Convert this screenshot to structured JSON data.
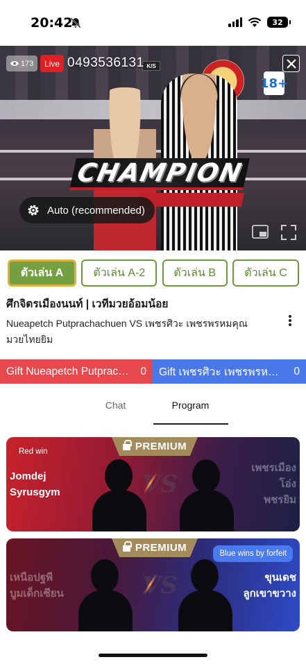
{
  "status_bar": {
    "time": "20:42",
    "battery": "32"
  },
  "video": {
    "view_count": "173",
    "live_label": "Live",
    "overlay_number": "0493536131",
    "overlay_champion_text": "CHAMPION",
    "rating_badge": "18+",
    "quality_label": "Auto (recommended)"
  },
  "player_tabs": [
    {
      "label": "ตัวเล่น A",
      "active": true
    },
    {
      "label": "ตัวเล่น A-2",
      "active": false
    },
    {
      "label": "ตัวเล่น B",
      "active": false
    },
    {
      "label": "ตัวเล่น C",
      "active": false
    }
  ],
  "event": {
    "title": "ศึกจิตรเมืองนนท์ | เวทีมวยอ้อมน้อย",
    "description": "Nueapetch Putprachachuen VS เพชรศิวะ เพชรพรหมคุณ มวยไทยยิม"
  },
  "gift": {
    "red_label": "Gift Nueapetch Putprachachuen",
    "red_count": "0",
    "blue_label": "Gift  เพชรศิวะ เพชรพรหมคุณ",
    "blue_count": "0"
  },
  "content_tabs": [
    {
      "label": "Chat",
      "active": false
    },
    {
      "label": "Program",
      "active": true
    }
  ],
  "program": [
    {
      "premium_label": "PREMIUM",
      "result": "Red win",
      "red_fighter": [
        "Jomdej",
        "Syrusgym"
      ],
      "blue_fighter": [
        "เพชรเมือง",
        "โอ่ง",
        "พชรยิม"
      ]
    },
    {
      "premium_label": "PREMIUM",
      "result": "Blue wins by forfeit",
      "red_fighter": [
        "เหนือปฐพี",
        "บูมเด็กเซียน"
      ],
      "blue_fighter": [
        "ขุนเดช",
        "ลูกเขาขวาง"
      ]
    }
  ],
  "colors": {
    "player_tab_green": "#75a041",
    "player_tab_border_gold": "#dcb23a",
    "gift_red": "#e7484d",
    "gift_blue": "#4979e9",
    "live_red": "#e02020",
    "premium_gold": "#a48b5c"
  }
}
